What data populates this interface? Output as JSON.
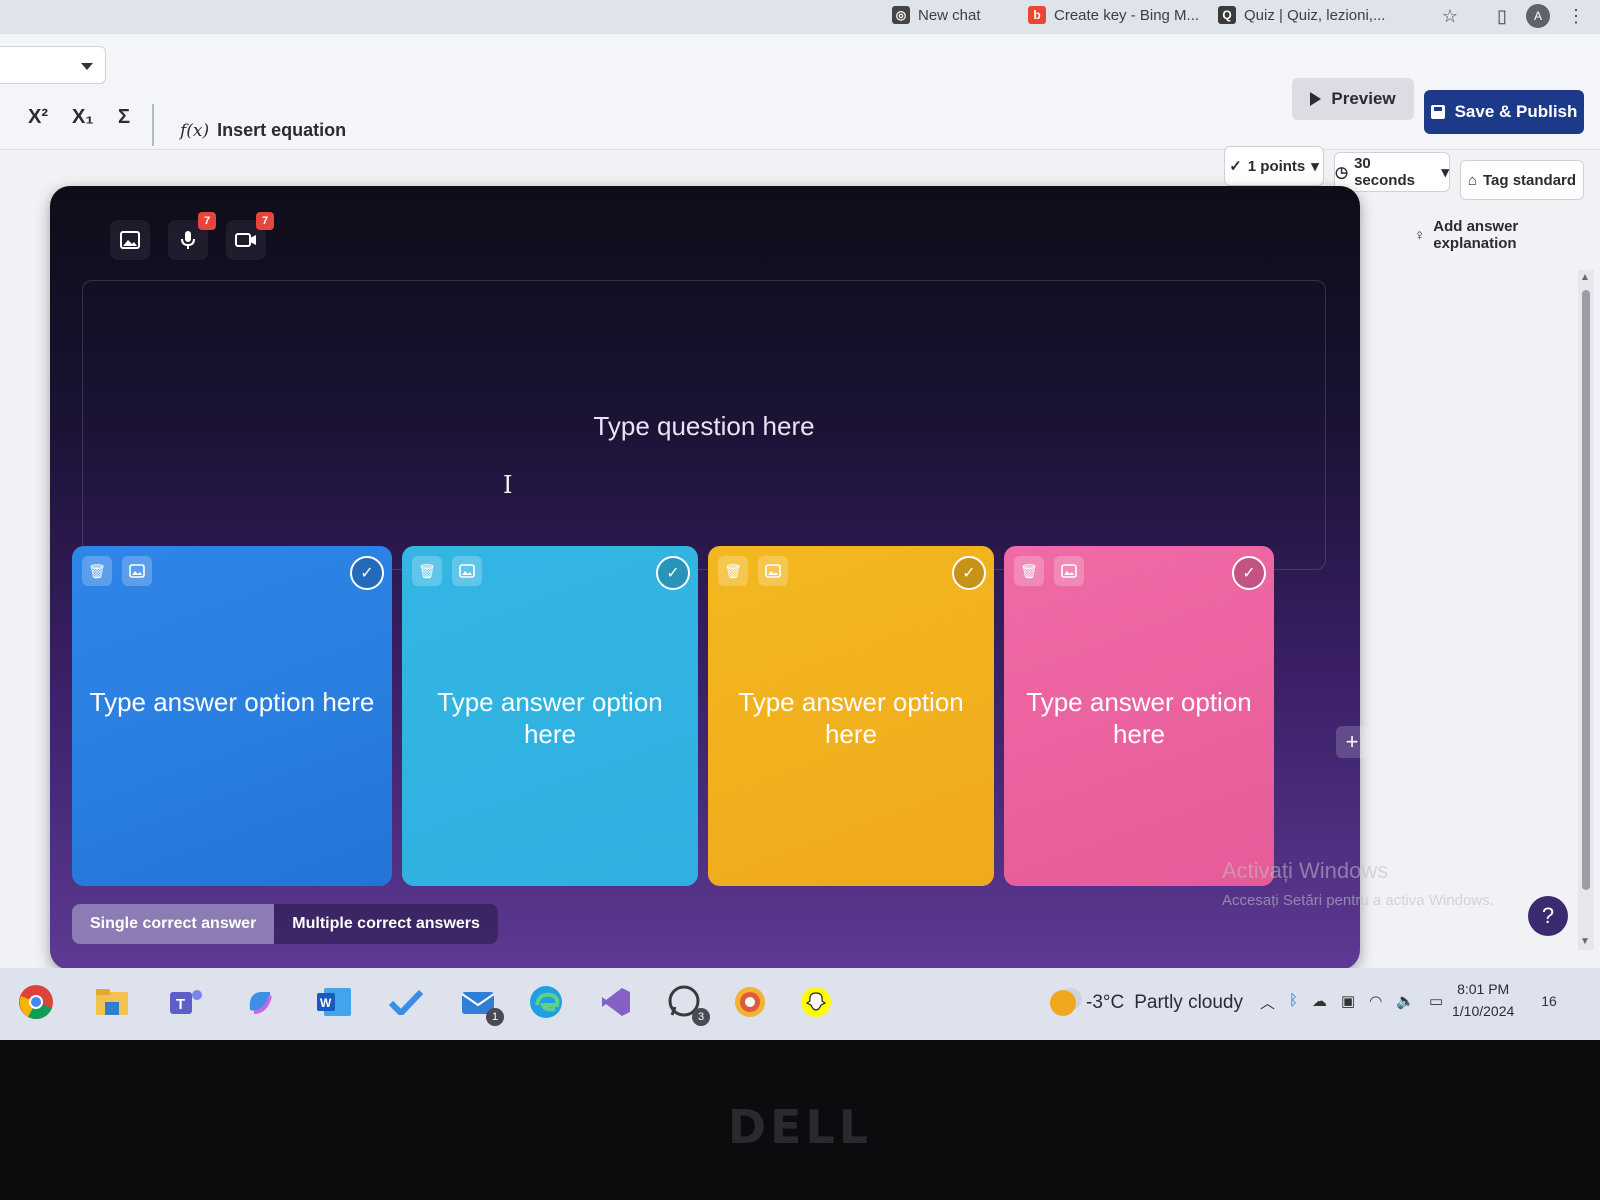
{
  "browser": {
    "tabs": [
      {
        "label": "New chat"
      },
      {
        "label": "Create key - Bing M..."
      },
      {
        "label": "Quiz | Quiz, lezioni,..."
      }
    ],
    "profile_initial": "A"
  },
  "toolbar": {
    "superscript": "X²",
    "subscript": "X₁",
    "sigma": "Σ",
    "fx": "f(x)",
    "insert_equation": "Insert equation",
    "preview_label": "Preview",
    "publish_label": "Save & Publish"
  },
  "settings": {
    "points": "1 points",
    "time": "30 seconds",
    "tag": "Tag standard",
    "explanation": "Add answer explanation"
  },
  "question": {
    "placeholder": "Type question here",
    "media_badges": [
      "7",
      "7"
    ]
  },
  "answers": [
    {
      "placeholder": "Type answer option here",
      "color": "#2f86e8"
    },
    {
      "placeholder": "Type answer option here",
      "color": "#33b6e4"
    },
    {
      "placeholder": "Type answer option here",
      "color": "#f3b81f"
    },
    {
      "placeholder": "Type answer option here",
      "color": "#ef6aa6"
    }
  ],
  "answer_mode": {
    "single": "Single correct answer",
    "multiple": "Multiple correct answers",
    "selected": "single"
  },
  "watermark": {
    "line1": "Activați Windows",
    "line2": "Accesați Setări pentru a activa Windows."
  },
  "help_label": "?",
  "taskbar": {
    "badges": {
      "mail": "1",
      "whatsapp": "3"
    },
    "temperature": "-3°C",
    "weather": "Partly cloudy",
    "time": "8:01 PM",
    "date": "1/10/2024",
    "notifications": "16"
  },
  "bezel_brand": "DELL"
}
